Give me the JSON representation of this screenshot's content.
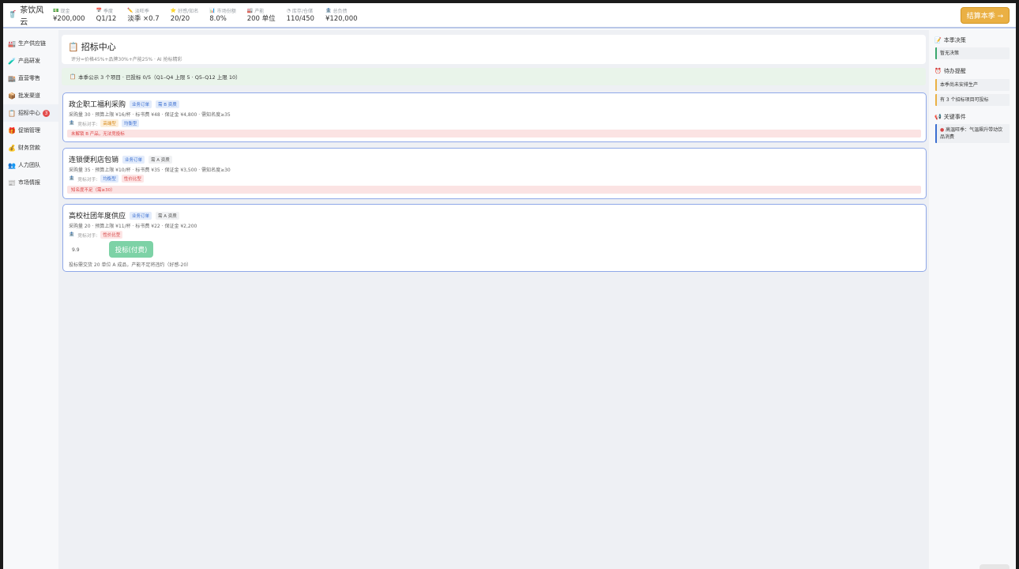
{
  "app": {
    "title": "茶饮风云",
    "logo_icon": "cup-icon"
  },
  "stats": [
    {
      "icon": "cash-icon",
      "label": "现金",
      "value": "¥200,000"
    },
    {
      "icon": "calendar-icon",
      "label": "季度",
      "value": "Q1/12"
    },
    {
      "icon": "pencil-icon",
      "label": "淡旺季",
      "value": "淡季 ×0.7"
    },
    {
      "icon": "star-icon",
      "label": "好感/知名",
      "value": "20/20"
    },
    {
      "icon": "chart-icon",
      "label": "市场份额",
      "value": "8.0%"
    },
    {
      "icon": "factory-icon",
      "label": "产能",
      "value": "200 单位"
    },
    {
      "icon": "gauge-icon",
      "label": "库存/仓储",
      "value": "110/450"
    },
    {
      "icon": "bank-icon",
      "label": "总负债",
      "value": "¥120,000"
    }
  ],
  "end_button": "结算本季 →",
  "sidebar": [
    {
      "icon": "factory-icon",
      "label": "生产供应链"
    },
    {
      "icon": "flask-icon",
      "label": "产品研发"
    },
    {
      "icon": "shop-icon",
      "label": "直营零售"
    },
    {
      "icon": "box-icon",
      "label": "批发渠道"
    },
    {
      "icon": "clipboard-icon",
      "label": "招标中心",
      "badge": "3",
      "active": true
    },
    {
      "icon": "gift-icon",
      "label": "促销管理"
    },
    {
      "icon": "moneybag-icon",
      "label": "财务贷款"
    },
    {
      "icon": "people-icon",
      "label": "人力团队"
    },
    {
      "icon": "newspaper-icon",
      "label": "市场情报"
    }
  ],
  "page": {
    "title": "招标中心",
    "subtitle": "评分=价格45%+品牌30%+产能25% · AI 抢标精彩",
    "notice": "本季公示 3 个项目 · 已投标 0/5（Q1–Q4 上限 5 · Q5–Q12 上限 10）"
  },
  "bids": [
    {
      "name": "政企职工福利采购",
      "tag_type": "业务订单",
      "tag_req": "需 B 资质",
      "meta": "采购量 30 · 预算上限 ¥16/杯 · 标书费 ¥48 · 保证金 ¥4,800 · 需知名度≥35",
      "competitor_label": "竞标对手:",
      "competitors": [
        {
          "label": "高端型",
          "color": "orange"
        },
        {
          "label": "均衡型",
          "color": "blue"
        }
      ],
      "warning": "未解锁 B 产品，无法竞投标"
    },
    {
      "name": "连锁便利店包销",
      "tag_type": "业务订单",
      "tag_req": "需 A 资质",
      "meta": "采购量 35 · 预算上限 ¥10/杯 · 标书费 ¥35 · 保证金 ¥3,500 · 需知名度≥30",
      "competitor_label": "竞标对手:",
      "competitors": [
        {
          "label": "均衡型",
          "color": "blue"
        },
        {
          "label": "性价比型",
          "color": "red"
        }
      ],
      "warning": "知名度不足（需≥30）"
    },
    {
      "name": "高校社团年度供应",
      "tag_type": "业务订单",
      "tag_req": "需 A 资质",
      "meta": "采购量 20 · 预算上限 ¥11/杯 · 标书费 ¥22 · 保证金 ¥2,200",
      "competitor_label": "竞标对手:",
      "competitors": [
        {
          "label": "性价比型",
          "color": "red"
        }
      ],
      "bid_value": "9.9",
      "bid_button": "投标(付费)",
      "note": "投标需交货 20 单位 A 成品，产能不足将违约（好感-20）"
    }
  ],
  "right_panel": {
    "decision_title": "本季决策",
    "decision_items": [
      "暂无决策"
    ],
    "todo_title": "待办提醒",
    "todo_items": [
      "本季尚未安排生产",
      "有 3 个招标项目可投标"
    ],
    "event_title": "关键事件",
    "event_items": [
      "高温旺季：气温飙升带动饮品消费"
    ]
  },
  "colors": {
    "accent": "#eab044",
    "card_border": "#8fa8e8",
    "bid_button": "#7dd2a6",
    "badge": "#e34b4b"
  }
}
